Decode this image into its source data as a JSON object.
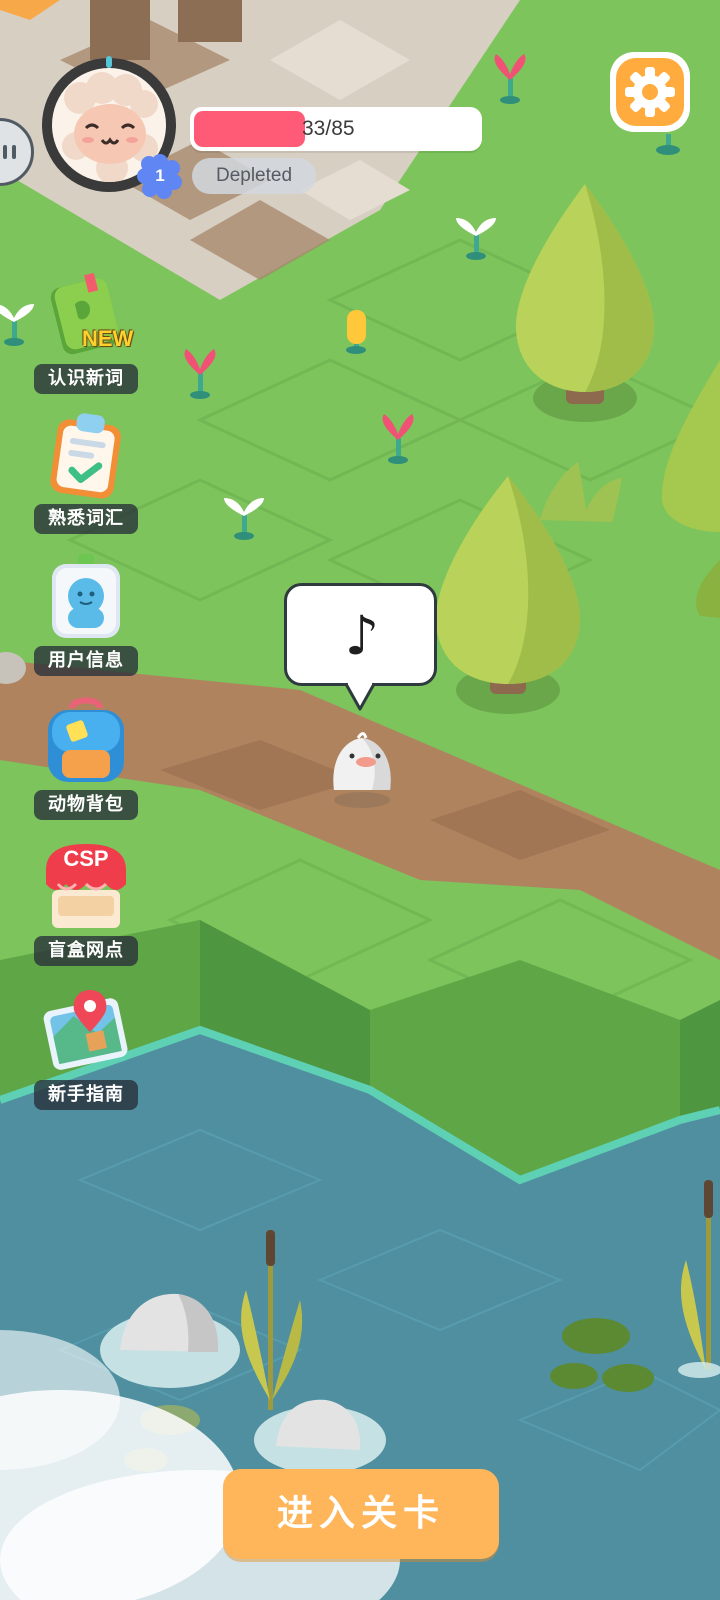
{
  "player": {
    "level": "1",
    "energy_text": "33/85",
    "energy_fraction": 0.39,
    "energy_status": "Depleted"
  },
  "menu": {
    "items": [
      {
        "label": "认识新词",
        "badge": "NEW",
        "icon": "green-book-icon"
      },
      {
        "label": "熟悉词汇",
        "icon": "clipboard-check-icon"
      },
      {
        "label": "用户信息",
        "icon": "user-id-badge-icon"
      },
      {
        "label": "动物背包",
        "icon": "backpack-icon"
      },
      {
        "label": "盲盒网点",
        "icon": "shop-icon",
        "sign": "CSP"
      },
      {
        "label": "新手指南",
        "icon": "map-pin-icon"
      }
    ]
  },
  "scene": {
    "speech_bubble": "♪"
  },
  "actions": {
    "enter_level": "进入关卡"
  },
  "colors": {
    "accent": "#ffb65a",
    "energy_fill": "#ff5a76",
    "grass": "#7cc45b",
    "path": "#b0835f",
    "water": "#4f8fa0"
  }
}
